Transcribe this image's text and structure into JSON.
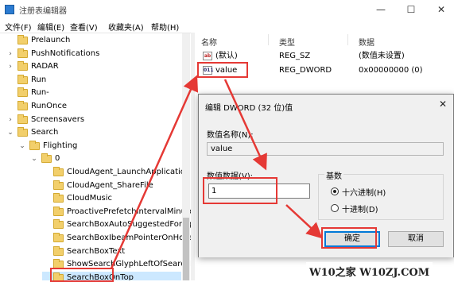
{
  "window": {
    "title": "注册表编辑器",
    "minimize": "—",
    "maximize": "☐",
    "close": "✕"
  },
  "menu": [
    "文件(F)",
    "编辑(E)",
    "查看(V)",
    "收藏夹(A)",
    "帮助(H)"
  ],
  "tree": {
    "items": [
      {
        "label": "Prelaunch",
        "level": 2,
        "expander": ""
      },
      {
        "label": "PushNotifications",
        "level": 2,
        "expander": ">"
      },
      {
        "label": "RADAR",
        "level": 2,
        "expander": ">"
      },
      {
        "label": "Run",
        "level": 2,
        "expander": ""
      },
      {
        "label": "Run-",
        "level": 2,
        "expander": ""
      },
      {
        "label": "RunOnce",
        "level": 2,
        "expander": ""
      },
      {
        "label": "Screensavers",
        "level": 2,
        "expander": ">"
      },
      {
        "label": "Search",
        "level": 2,
        "expander": "v"
      },
      {
        "label": "Flighting",
        "level": 3,
        "expander": "v"
      },
      {
        "label": "0",
        "level": 4,
        "expander": "v"
      },
      {
        "label": "CloudAgent_LaunchApplication",
        "level": 5,
        "expander": ""
      },
      {
        "label": "CloudAgent_ShareFile",
        "level": 5,
        "expander": ""
      },
      {
        "label": "CloudMusic",
        "level": 5,
        "expander": ""
      },
      {
        "label": "ProactivePrefetchIntervalMinutes",
        "level": 5,
        "expander": ""
      },
      {
        "label": "SearchBoxAutoSuggestedForeground",
        "level": 5,
        "expander": ""
      },
      {
        "label": "SearchBoxIbeamPointerOnHover",
        "level": 5,
        "expander": ""
      },
      {
        "label": "SearchBoxText",
        "level": 5,
        "expander": ""
      },
      {
        "label": "ShowSearchGlyphLeftOfSearchBox",
        "level": 5,
        "expander": ""
      },
      {
        "label": "SearchBoxOnTop",
        "level": 5,
        "expander": "",
        "selected": true
      }
    ]
  },
  "list": {
    "columns": [
      "名称",
      "类型",
      "数据"
    ],
    "rows": [
      {
        "icon": "ab",
        "name": "(默认)",
        "type": "REG_SZ",
        "data": "(数值未设置)"
      },
      {
        "icon": "011",
        "name": "value",
        "type": "REG_DWORD",
        "data": "0x00000000 (0)"
      }
    ]
  },
  "dialog": {
    "title": "编辑 DWORD (32 位)值",
    "close": "✕",
    "name_label": "数值名称(N):",
    "name_value": "value",
    "data_label": "数值数据(V):",
    "data_value": "1",
    "base_label": "基数",
    "hex_label": "十六进制(H)",
    "dec_label": "十进制(D)",
    "ok_label": "确定",
    "cancel_label": "取消",
    "selected_base": "hex"
  },
  "watermark": "W10之家 W10ZJ.COM",
  "colors": {
    "annotation": "#e53935",
    "selection": "#cce8ff",
    "folder": "#f2cf6b"
  }
}
